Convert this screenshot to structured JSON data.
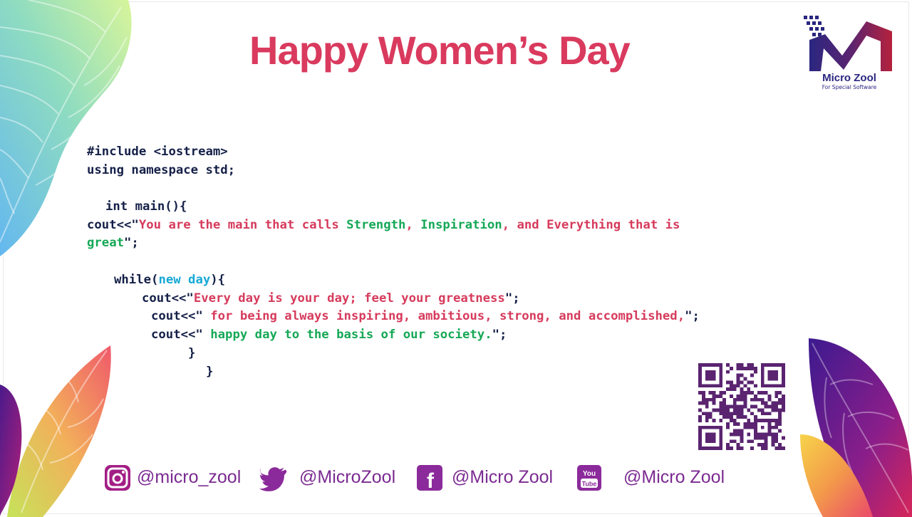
{
  "title": "Happy Women’s Day",
  "logo": {
    "name": "Micro Zool",
    "tagline": "For Special Software"
  },
  "code": {
    "include": "#include <iostream>",
    "using": "using namespace std;",
    "main_open": "int main(){",
    "cout1_prefix": "cout<<\"",
    "cout1_seg1": "You are the main that calls ",
    "cout1_seg2": "Strength",
    "cout1_seg3": ", ",
    "cout1_seg4": "Inspiration",
    "cout1_seg5": ", and Everything that is",
    "cout1_seg6": "great",
    "cout1_end": "\";",
    "while_kw": "while(",
    "while_new": "new",
    "while_day": " day",
    "while_end": "){",
    "cout2_prefix": "cout<<\"",
    "cout2_text": "Every day is your day; feel your greatness",
    "cout2_end": "\";",
    "cout3_prefix": "cout<<\"",
    "cout3_text": " for being always inspiring, ambitious, strong, and accomplished,",
    "cout3_end": "\";",
    "cout4_prefix": "cout<<\"",
    "cout4_text": " happy day to the basis of our society.",
    "cout4_end": "\";",
    "close1": "}",
    "close2": "}"
  },
  "social": {
    "instagram": "@micro_zool",
    "twitter": "@MicroZool",
    "facebook": "@Micro Zool",
    "youtube": "@Micro Zool",
    "youtube_icon_label": "You Tube",
    "facebook_icon_label": "f"
  },
  "colors": {
    "title": "#d93a5e",
    "code_dark": "#152048",
    "code_pink": "#d63b5c",
    "code_green": "#16a856",
    "code_blue": "#16a8d6",
    "social": "#7b2a91",
    "logo_blue": "#2a2680",
    "logo_red": "#b5213c"
  },
  "icons": [
    "instagram-icon",
    "twitter-icon",
    "facebook-icon",
    "youtube-icon",
    "qr-code"
  ]
}
